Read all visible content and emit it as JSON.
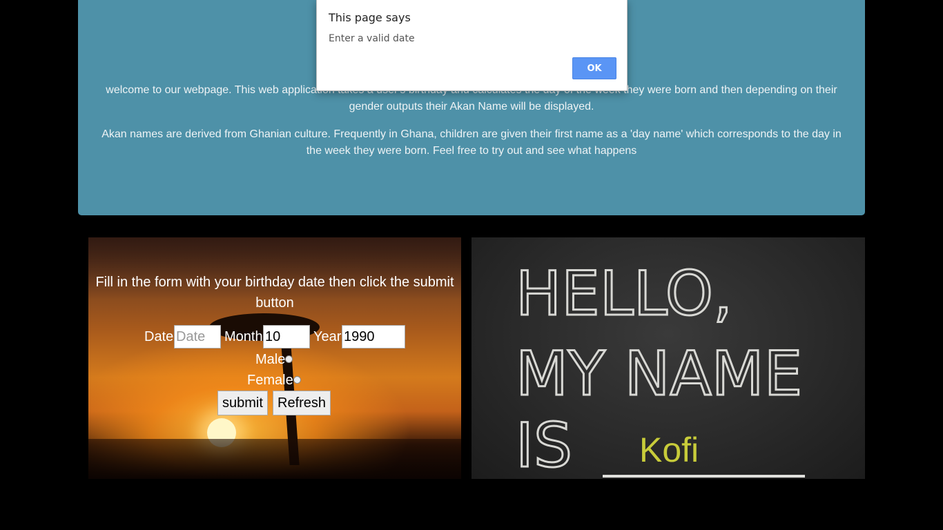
{
  "hero": {
    "paragraph_1": "welcome to our webpage. This web application takes a user's birthday and calculates the day of the week they were born and then depending on their gender outputs their Akan Name will be displayed.",
    "paragraph_2": "Akan names are derived from Ghanian culture. Frequently in Ghana, children are given their first name as a 'day name' which corresponds to the day in the week they were born. Feel free to try out and see what happens"
  },
  "form": {
    "title": "Fill in the form with your birthday date then click the submit button",
    "date_label": "Date",
    "date_placeholder": "Date",
    "date_value": "",
    "month_label": "Month",
    "month_value": "10",
    "year_label": "Year",
    "year_value": "1990",
    "male_label": "Male",
    "female_label": "Female",
    "submit_label": "submit",
    "refresh_label": "Refresh"
  },
  "result": {
    "chalk_text": [
      "HELLO,",
      "MY NAME",
      "IS"
    ],
    "akan_name": "Kofi"
  },
  "dialog": {
    "title": "This page says",
    "message": "Enter a valid date",
    "ok_label": "OK"
  },
  "colors": {
    "hero_bg": "#4e91a8",
    "name_color": "#c8cc3a",
    "ok_button": "#5a95f5"
  }
}
